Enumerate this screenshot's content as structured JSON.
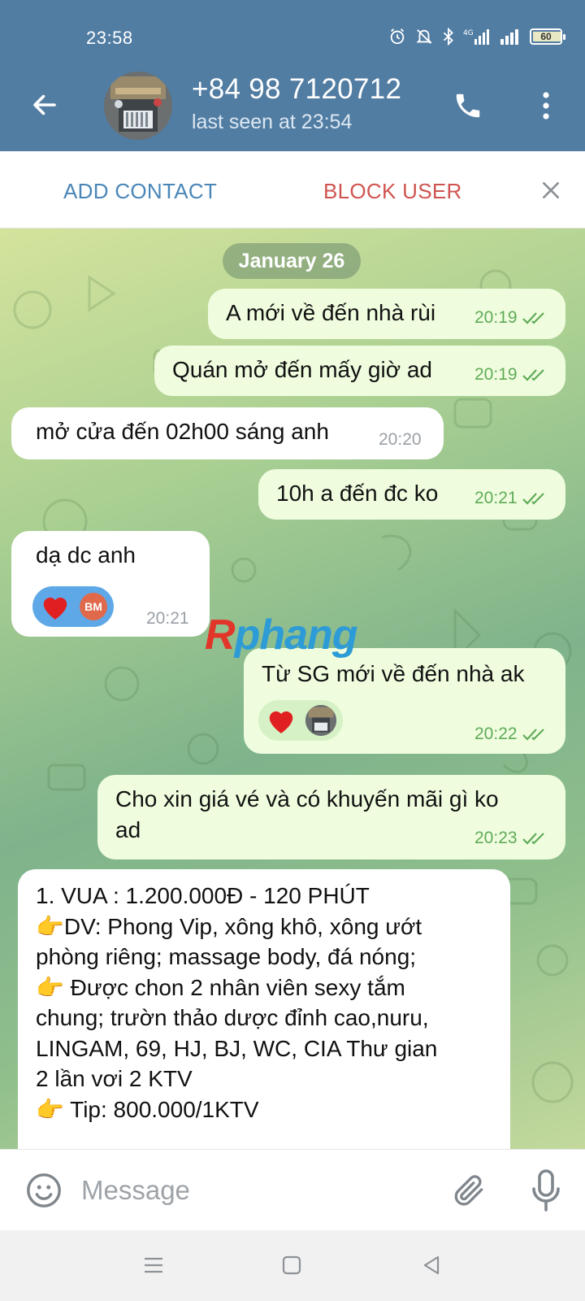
{
  "status_bar": {
    "time": "23:58",
    "battery": "60"
  },
  "header": {
    "contact_name": "+84 98 7120712",
    "last_seen": "last seen at 23:54"
  },
  "actions": {
    "add_contact": "ADD CONTACT",
    "block_user": "BLOCK USER"
  },
  "chat": {
    "date_separator": "January 26",
    "messages": [
      {
        "direction": "out",
        "text": "A mới về đến nhà rùi",
        "time": "20:19"
      },
      {
        "direction": "out",
        "text": "Quán mở đến mấy giờ ad",
        "time": "20:19"
      },
      {
        "direction": "in",
        "text": "mở cửa đến 02h00 sáng anh",
        "time": "20:20"
      },
      {
        "direction": "out",
        "text": "10h a đến đc ko",
        "time": "20:21"
      },
      {
        "direction": "in",
        "text": "dạ dc anh",
        "time": "20:21",
        "reaction_badge": "BM"
      },
      {
        "direction": "out",
        "text": "Từ SG mới về đến nhà ak",
        "time": "20:22"
      },
      {
        "direction": "out",
        "lines": [
          "Cho xin giá vé và có khuyến mãi gì ko",
          "ad"
        ],
        "time": "20:23"
      },
      {
        "direction": "in",
        "lines": [
          "1. VUA : 1.200.000Đ - 120 PHÚT",
          "👉DV: Phong Vip, xông khô, xông ướt",
          "phòng riêng; massage body, đá nóng;",
          "👉 Được chon 2 nhân viên sexy tắm",
          "chung; trườn thảo dược đỉnh cao,nuru,",
          "LINGAM, 69, HJ, BJ, WC, CIA Thư gian",
          "2 lần vơi 2 KTV",
          "👉 Tip: 800.000/1KTV"
        ]
      }
    ]
  },
  "watermark": {
    "part1": "R",
    "part2": "phang"
  },
  "input": {
    "placeholder": "Message"
  },
  "colors": {
    "header": "#527da3",
    "outgoing_bubble": "#effdde",
    "incoming_bubble": "#ffffff",
    "ticks": "#5fab58",
    "block_user": "#cf5450",
    "add_contact": "#4a86b8"
  }
}
